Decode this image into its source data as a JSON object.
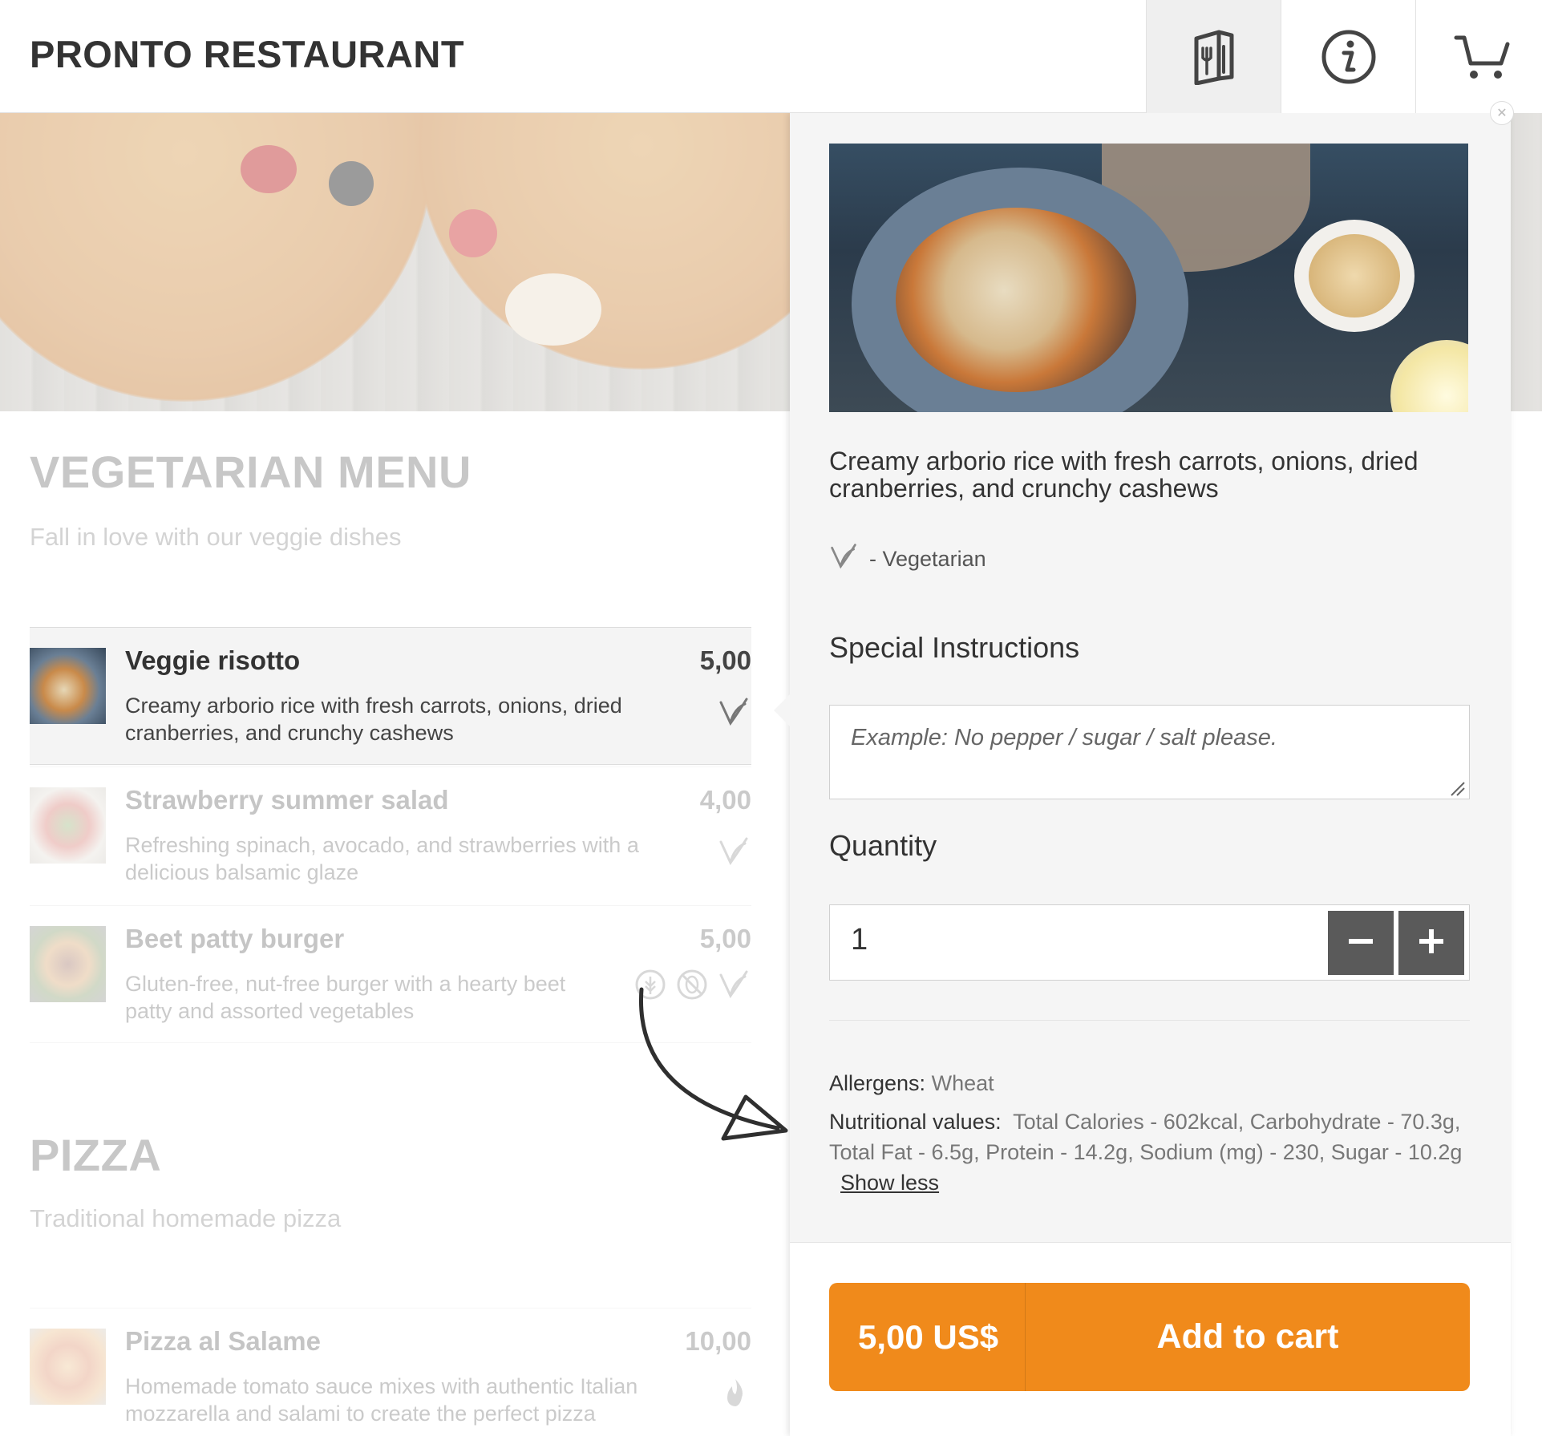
{
  "header": {
    "brand": "PRONTO RESTAURANT",
    "menu_icon": "menu-book-icon",
    "info_icon": "info-icon",
    "cart_icon": "cart-icon"
  },
  "sections": [
    {
      "title": "VEGETARIAN MENU",
      "subtitle": "Fall in love with our veggie dishes",
      "items": [
        {
          "name": "Veggie risotto",
          "description": "Creamy arborio rice with fresh carrots, onions, dried cranberries, and crunchy cashews",
          "price": "5,00",
          "icons": [
            "vegetarian-icon"
          ]
        },
        {
          "name": "Strawberry summer salad",
          "description": "Refreshing spinach, avocado, and strawberries with a delicious balsamic glaze",
          "price": "4,00",
          "icons": [
            "vegetarian-icon"
          ]
        },
        {
          "name": "Beet patty burger",
          "description": "Gluten-free, nut-free burger with a hearty beet patty and assorted vegetables",
          "price": "5,00",
          "icons": [
            "gluten-free-icon",
            "nut-free-icon",
            "vegetarian-icon"
          ]
        }
      ]
    },
    {
      "title": "PIZZA",
      "subtitle": "Traditional homemade pizza",
      "items": [
        {
          "name": "Pizza al Salame",
          "description": "Homemade tomato sauce mixes with authentic Italian mozzarella and salami to create the perfect pizza",
          "price": "10,00",
          "icons": [
            "spicy-icon"
          ]
        }
      ]
    }
  ],
  "panel": {
    "description": "Creamy arborio rice with fresh carrots, onions, dried cranberries, and crunchy cashews",
    "tag_label": "- Vegetarian",
    "special_instructions_label": "Special Instructions",
    "special_instructions_placeholder": "Example: No pepper / sugar / salt please.",
    "quantity_label": "Quantity",
    "quantity_value": "1",
    "allergens_label": "Allergens:",
    "allergens_value": "Wheat",
    "nutrition_label": "Nutritional values:",
    "nutrition_value": "Total Calories - 602kcal, Carbohydrate - 70.3g, Total Fat - 6.5g, Protein - 14.2g, Sodium (mg) - 230, Sugar - 10.2g",
    "show_less": "Show less",
    "cart_price": "5,00 US$",
    "add_to_cart": "Add to cart"
  },
  "colors": {
    "accent": "#f08a1b",
    "qty_button": "#5a5a5a",
    "panel_bg": "#f5f5f5"
  }
}
